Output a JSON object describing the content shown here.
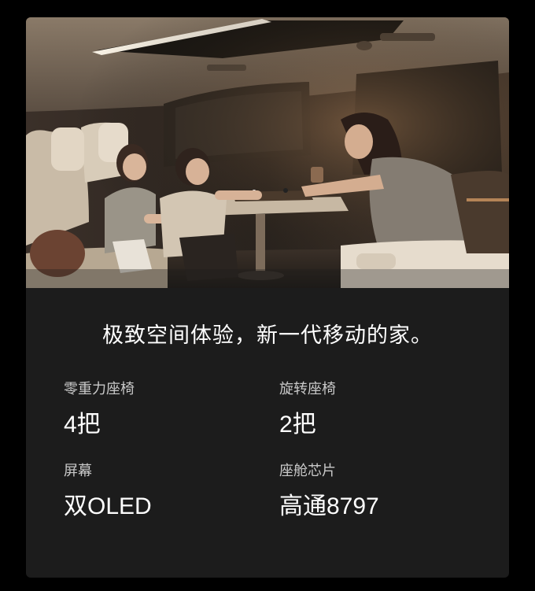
{
  "hero": {
    "image_alt_icon": "family-in-car-photo"
  },
  "tagline": "极致空间体验，新一代移动的家。",
  "specs": [
    {
      "label": "零重力座椅",
      "value": "4把"
    },
    {
      "label": "旋转座椅",
      "value": "2把"
    },
    {
      "label": "屏幕",
      "value": "双OLED"
    },
    {
      "label": "座舱芯片",
      "value": "高通8797"
    }
  ],
  "colors": {
    "background": "#000000",
    "card": "#1c1c1c",
    "label": "#c9c9c9",
    "value": "#ffffff"
  }
}
